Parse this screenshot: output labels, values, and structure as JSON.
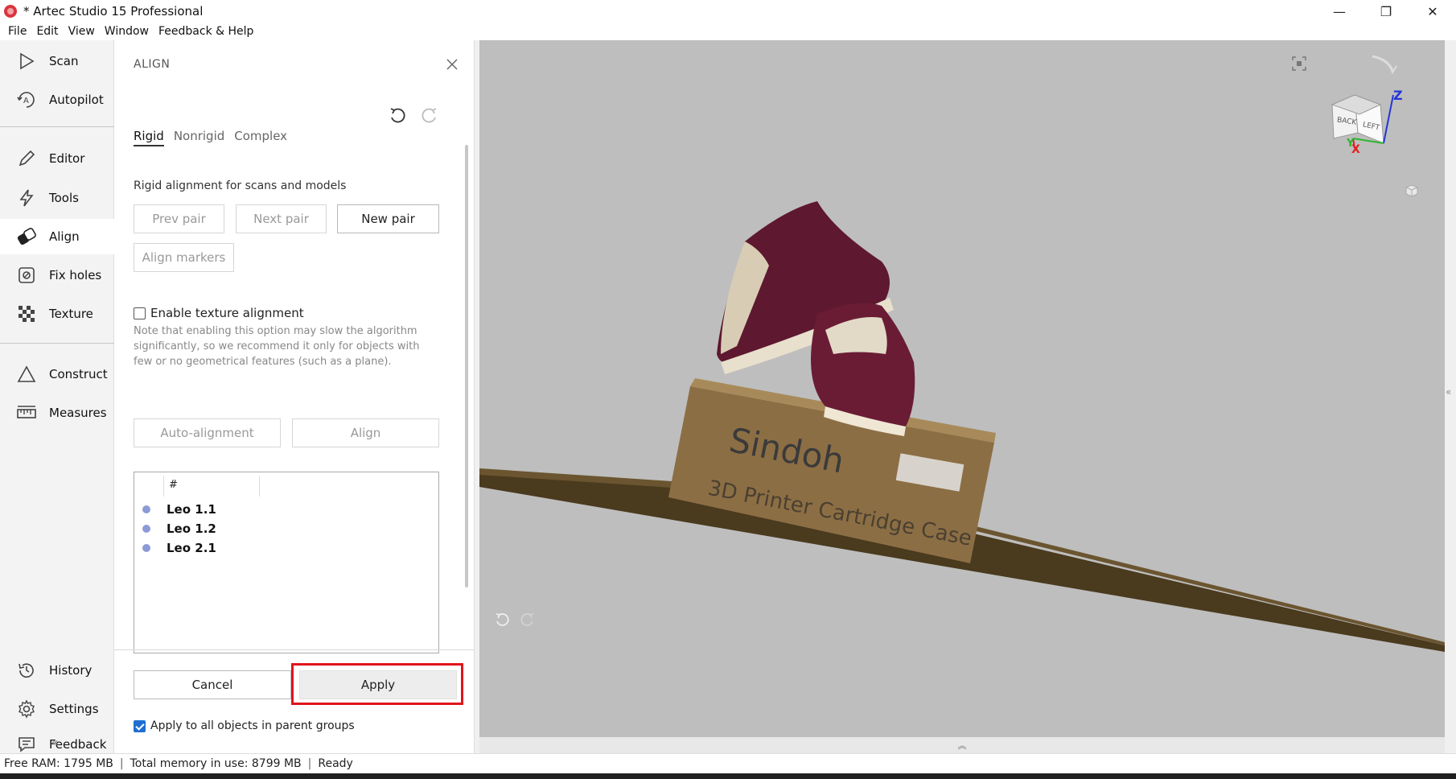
{
  "window": {
    "title": "* Artec Studio 15 Professional",
    "minimize": "—",
    "maximize": "❐",
    "close": "✕"
  },
  "menu": [
    "File",
    "Edit",
    "View",
    "Window",
    "Feedback & Help"
  ],
  "nav": {
    "scan": "Scan",
    "autopilot": "Autopilot",
    "editor": "Editor",
    "tools": "Tools",
    "align": "Align",
    "fix_holes": "Fix holes",
    "texture": "Texture",
    "construct": "Construct",
    "measures": "Measures",
    "history": "History",
    "settings": "Settings",
    "feedback": "Feedback",
    "collapse": "«"
  },
  "panel": {
    "title": "ALIGN",
    "tabs": [
      "Rigid",
      "Nonrigid",
      "Complex"
    ],
    "description": "Rigid alignment for scans and models",
    "buttons": {
      "prev_pair": "Prev pair",
      "next_pair": "Next pair",
      "new_pair": "New pair",
      "align_markers": "Align markers",
      "auto_alignment": "Auto-alignment",
      "align": "Align"
    },
    "texture_checkbox": "Enable texture alignment",
    "note": "Note that enabling this option may slow the algorithm significantly, so we recommend it only for objects with few or no geometrical features (such as a plane).",
    "list_header": "#",
    "items": [
      "Leo 1.1",
      "Leo 1.2",
      "Leo 2.1"
    ],
    "cancel": "Cancel",
    "apply": "Apply",
    "apply_all_checkbox": "Apply to all objects in parent groups"
  },
  "viewport": {
    "cube_faces": [
      "BACK",
      "LEFT"
    ],
    "axis_z": "Z",
    "axis_x": "X",
    "axis_y": "Y",
    "box_brand": "Sindoh",
    "box_subtitle": "3D Printer Cartridge Case",
    "expand_right": "«",
    "expand_bottom": "︽"
  },
  "status": {
    "free_ram": "Free RAM: 1795 MB",
    "total_memory": "Total memory in use: 8799 MB",
    "state": "Ready",
    "separator": "|"
  },
  "colors": {
    "highlight": "#e0141c",
    "viewport_bg": "#bebebe",
    "checkbox_checked": "#1f6fd1"
  }
}
